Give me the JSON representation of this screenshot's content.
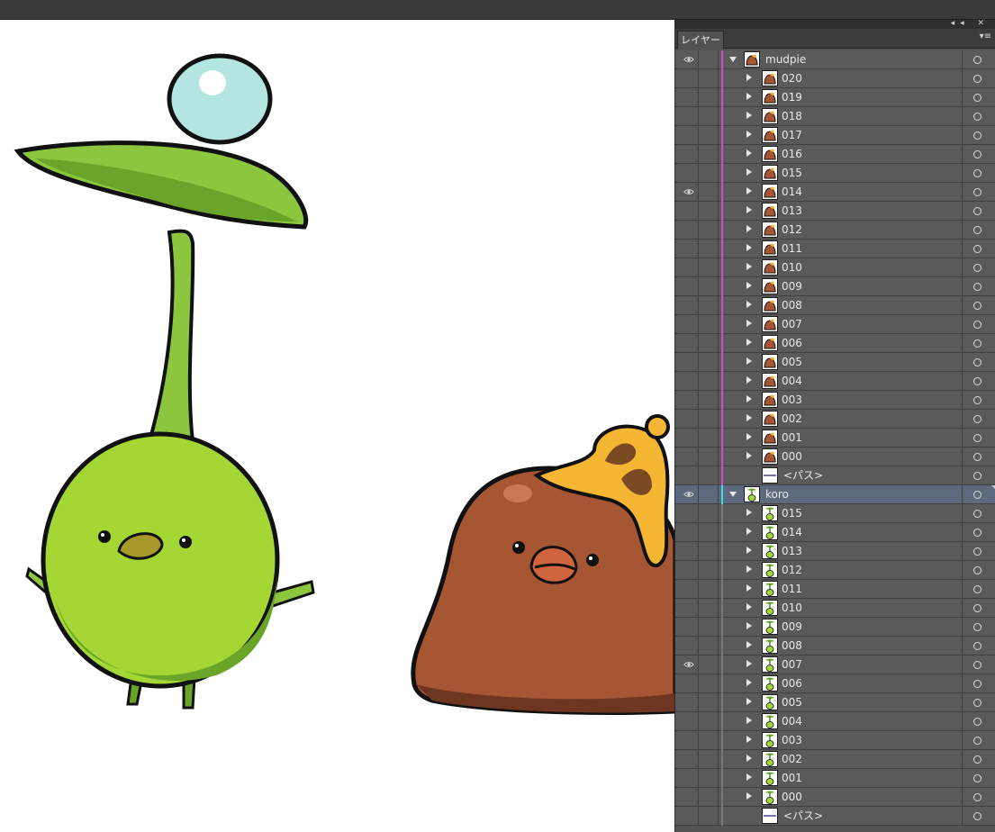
{
  "panel": {
    "tab_label": "レイヤー",
    "strip_buttons": "◂◂ ✕",
    "menu_icon": "▾≡"
  },
  "layers": [
    {
      "name": "mudpie",
      "level": 0,
      "expanded": true,
      "visible": true,
      "thumb": "mud",
      "color": "#c84fd0"
    },
    {
      "name": "020",
      "level": 1,
      "thumb": "mud",
      "color": "#c84fd0"
    },
    {
      "name": "019",
      "level": 1,
      "thumb": "mud",
      "color": "#c84fd0"
    },
    {
      "name": "018",
      "level": 1,
      "thumb": "mud",
      "color": "#c84fd0"
    },
    {
      "name": "017",
      "level": 1,
      "thumb": "mud",
      "color": "#c84fd0"
    },
    {
      "name": "016",
      "level": 1,
      "thumb": "mud",
      "color": "#c84fd0"
    },
    {
      "name": "015",
      "level": 1,
      "thumb": "mud",
      "color": "#c84fd0"
    },
    {
      "name": "014",
      "level": 1,
      "visible": true,
      "thumb": "mud",
      "color": "#c84fd0"
    },
    {
      "name": "013",
      "level": 1,
      "thumb": "mud",
      "color": "#c84fd0"
    },
    {
      "name": "012",
      "level": 1,
      "thumb": "mud",
      "color": "#c84fd0"
    },
    {
      "name": "011",
      "level": 1,
      "thumb": "mud",
      "color": "#c84fd0"
    },
    {
      "name": "010",
      "level": 1,
      "thumb": "mud",
      "color": "#c84fd0"
    },
    {
      "name": "009",
      "level": 1,
      "thumb": "mud",
      "color": "#c84fd0"
    },
    {
      "name": "008",
      "level": 1,
      "thumb": "mud",
      "color": "#c84fd0"
    },
    {
      "name": "007",
      "level": 1,
      "thumb": "mud",
      "color": "#c84fd0"
    },
    {
      "name": "006",
      "level": 1,
      "thumb": "mud",
      "color": "#c84fd0"
    },
    {
      "name": "005",
      "level": 1,
      "thumb": "mud",
      "color": "#c84fd0"
    },
    {
      "name": "004",
      "level": 1,
      "thumb": "mud",
      "color": "#c84fd0"
    },
    {
      "name": "003",
      "level": 1,
      "thumb": "mud",
      "color": "#c84fd0"
    },
    {
      "name": "002",
      "level": 1,
      "thumb": "mud",
      "color": "#c84fd0"
    },
    {
      "name": "001",
      "level": 1,
      "thumb": "mud",
      "color": "#c84fd0"
    },
    {
      "name": "000",
      "level": 1,
      "thumb": "mud",
      "color": "#c84fd0"
    },
    {
      "name": "<パス>",
      "level": 2,
      "thumb": "path",
      "color": "#c84fd0"
    },
    {
      "name": "koro",
      "level": 0,
      "expanded": true,
      "visible": true,
      "selected": true,
      "thumb": "sprout",
      "color": "#3fd8e6"
    },
    {
      "name": "015",
      "level": 1,
      "thumb": "sprout",
      "color": "#777777"
    },
    {
      "name": "014",
      "level": 1,
      "thumb": "sprout",
      "color": "#777777"
    },
    {
      "name": "013",
      "level": 1,
      "thumb": "sprout",
      "color": "#777777"
    },
    {
      "name": "012",
      "level": 1,
      "thumb": "sprout",
      "color": "#777777"
    },
    {
      "name": "011",
      "level": 1,
      "thumb": "sprout",
      "color": "#777777"
    },
    {
      "name": "010",
      "level": 1,
      "thumb": "sprout",
      "color": "#777777"
    },
    {
      "name": "009",
      "level": 1,
      "thumb": "sprout",
      "color": "#777777"
    },
    {
      "name": "008",
      "level": 1,
      "thumb": "sprout",
      "color": "#777777"
    },
    {
      "name": "007",
      "level": 1,
      "visible": true,
      "thumb": "sprout",
      "color": "#777777"
    },
    {
      "name": "006",
      "level": 1,
      "thumb": "sprout",
      "color": "#777777"
    },
    {
      "name": "005",
      "level": 1,
      "thumb": "sprout",
      "color": "#777777"
    },
    {
      "name": "004",
      "level": 1,
      "thumb": "sprout",
      "color": "#777777"
    },
    {
      "name": "003",
      "level": 1,
      "thumb": "sprout",
      "color": "#777777"
    },
    {
      "name": "002",
      "level": 1,
      "thumb": "sprout",
      "color": "#777777"
    },
    {
      "name": "001",
      "level": 1,
      "thumb": "sprout",
      "color": "#777777"
    },
    {
      "name": "000",
      "level": 1,
      "thumb": "sprout",
      "color": "#777777"
    },
    {
      "name": "<パス>",
      "level": 2,
      "thumb": "path",
      "color": "#777777"
    }
  ],
  "icons": {
    "visibility": "eye-icon",
    "expand": "disclosure-triangle-icon",
    "target": "target-circle-icon"
  }
}
